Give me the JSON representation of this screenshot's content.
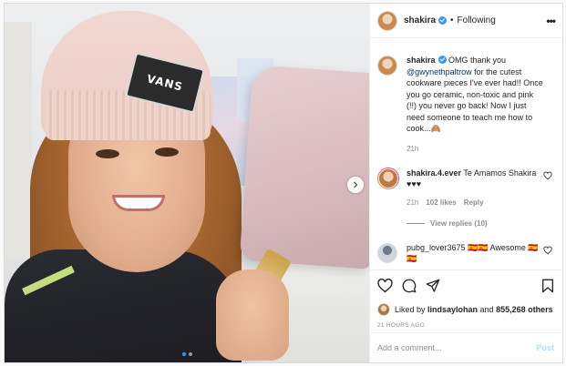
{
  "post": {
    "image_alt": "Selfie holding a pink ceramic pan",
    "hat_patch_text": "VANS",
    "carousel": {
      "dots": 2,
      "active_index": 0
    }
  },
  "header": {
    "username": "shakira",
    "separator": "•",
    "follow_state": "Following",
    "more": "•••"
  },
  "caption": {
    "username": "shakira",
    "parts": [
      {
        "text": " OMG thank you "
      },
      {
        "text": "@gwynethpaltrow",
        "mention": true
      },
      {
        "text": " for the cutest cookware pieces I've ever had!! Once you go ceramic, non-toxic and pink (!!) you never go back! Now I just need someone to teach me how to cook...🙈"
      }
    ],
    "time": "21h"
  },
  "comments": [
    {
      "username": "shakira.4.ever",
      "text": " Te Amamos Shakira ♥♥♥",
      "time": "21h",
      "likes": "102 likes",
      "reply": "Reply",
      "view_replies": "View replies (10)"
    },
    {
      "username": "pubg_lover3675",
      "text": " 🇪🇸🇪🇸 Awesome 🇪🇸🇪🇸"
    }
  ],
  "actions": {
    "liked_by_prefix": "Liked by ",
    "liked_by_user": "lindsaylohan",
    "liked_by_suffix": " and ",
    "liked_count": "855,268 others",
    "timestamp": "21 HOURS AGO"
  },
  "add_comment": {
    "placeholder": "Add a comment...",
    "post_label": "Post"
  },
  "colors": {
    "link": "#00376b",
    "verified": "#3897f0",
    "muted": "#8e8e8e",
    "post_disabled": "#b2dffc"
  }
}
